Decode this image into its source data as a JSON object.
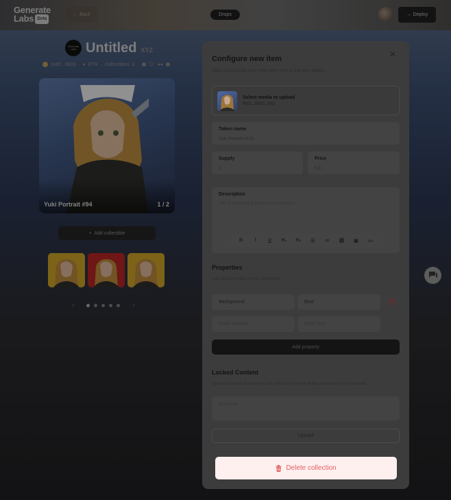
{
  "header": {
    "logo_line1": "Generate",
    "logo_line2": "Labs",
    "logo_badge": "Beta",
    "back_label": "Back",
    "drops_label": "Drops",
    "deploy_label": "Deploy"
  },
  "collection": {
    "logo_text": "Generate Labs",
    "title": "Untitled",
    "suffix": "XYZ",
    "address": "0x85...0b33",
    "chain": "ETH",
    "collectibles_label": "Collectibles: 3"
  },
  "preview": {
    "name": "Yuki Portrait #94",
    "count": "1 / 2"
  },
  "add_collectible_label": "Add collectible",
  "pager": {
    "prev": "‹",
    "next": "›",
    "dots": 5,
    "active": 0
  },
  "modal": {
    "title": "Configure new item",
    "subtitle": "Start configuring your new item with a few key details",
    "close_glyph": "✕",
    "media": {
      "title": "Select media to upload",
      "formats": "PNG, JPEG, JPG"
    },
    "token_name": {
      "label": "Token name",
      "value": "Yuki Portrait #123"
    },
    "supply": {
      "label": "Supply",
      "value": "2"
    },
    "price": {
      "label": "Price",
      "value": "0.3"
    },
    "description": {
      "label": "Description",
      "placeholder": "Tell us everything about your collection"
    },
    "toolbar": [
      "B",
      "I",
      "U",
      "H₁",
      "H₂",
      "☰",
      "≔",
      "⛓",
      "▣",
      "▭"
    ],
    "properties": {
      "title": "Properties",
      "subtitle": "Add custom traits to this collectible",
      "rows": [
        {
          "key": "Background",
          "value": "Blue"
        }
      ],
      "attr_placeholder": "Enter attribute",
      "value_placeholder": "Enter trait",
      "add_label": "Add property"
    },
    "locked": {
      "title": "Locked Content",
      "subtitle": "Upload content that buyers can unlock once the digital collectible is purchased",
      "placeholder": "Enter text",
      "upload_label": "Upload"
    },
    "delete_label": "Delete collection"
  },
  "colors": {
    "delete_bg": "#fff0f0",
    "delete_text": "#e46060",
    "modal_bg": "#3c3c3d"
  }
}
